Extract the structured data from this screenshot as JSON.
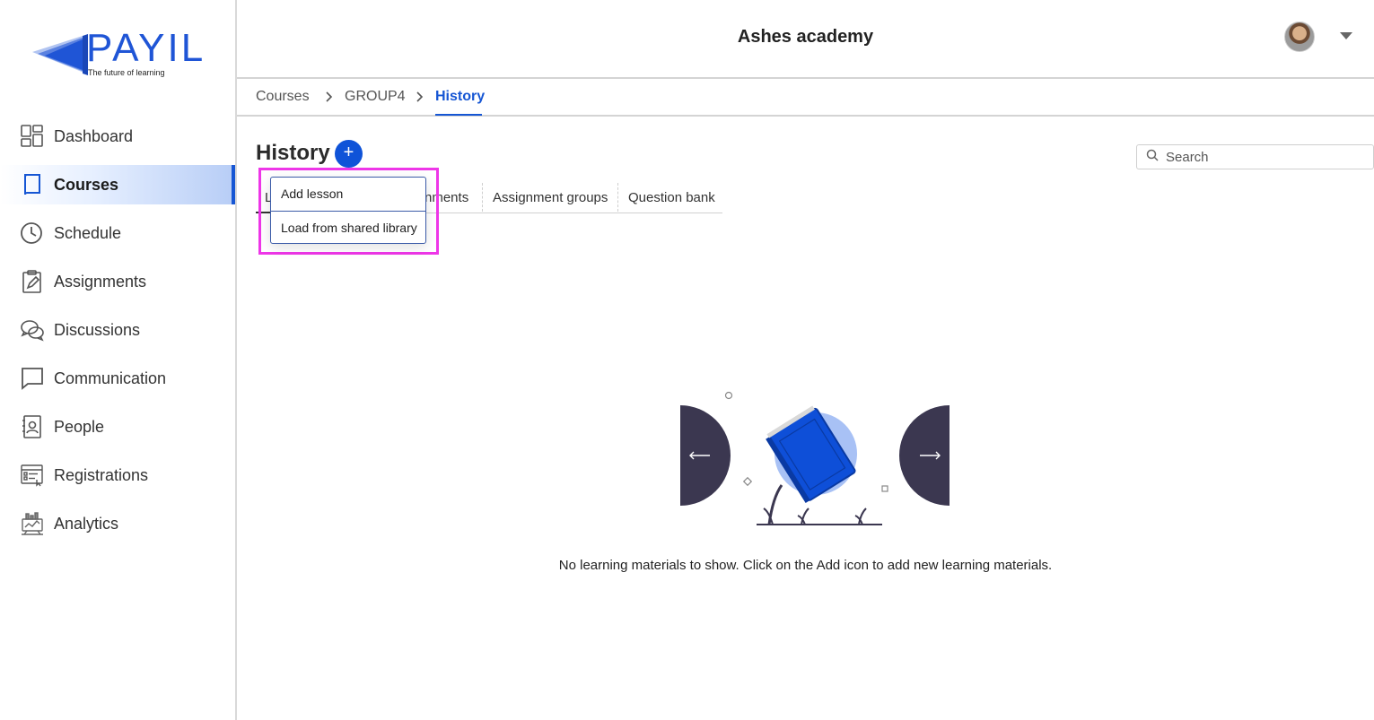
{
  "app": {
    "logo_text": "PAYIL",
    "logo_tagline": "The future of learning",
    "brand_color": "#1656d4"
  },
  "sidebar": {
    "items": [
      {
        "label": "Dashboard",
        "icon": "dashboard-icon",
        "active": false
      },
      {
        "label": "Courses",
        "icon": "book-icon",
        "active": true
      },
      {
        "label": "Schedule",
        "icon": "clock-icon",
        "active": false
      },
      {
        "label": "Assignments",
        "icon": "clipboard-icon",
        "active": false
      },
      {
        "label": "Discussions",
        "icon": "chat-bubbles-icon",
        "active": false
      },
      {
        "label": "Communication",
        "icon": "message-icon",
        "active": false
      },
      {
        "label": "People",
        "icon": "person-card-icon",
        "active": false
      },
      {
        "label": "Registrations",
        "icon": "registration-form-icon",
        "active": false
      },
      {
        "label": "Analytics",
        "icon": "analytics-icon",
        "active": false
      }
    ]
  },
  "header": {
    "title": "Ashes academy"
  },
  "breadcrumb": {
    "items": [
      "Courses",
      "GROUP4",
      "History"
    ],
    "separator": ">"
  },
  "page": {
    "title": "History",
    "add_button": "+",
    "search_placeholder": "Search"
  },
  "tabs": {
    "items": [
      "L",
      "nments",
      "Assignment groups",
      "Question bank"
    ]
  },
  "add_menu": {
    "items": [
      "Add lesson",
      "Load from shared library"
    ]
  },
  "empty_state": {
    "message": "No learning materials to show. Click on the Add icon to add new learning materials."
  }
}
